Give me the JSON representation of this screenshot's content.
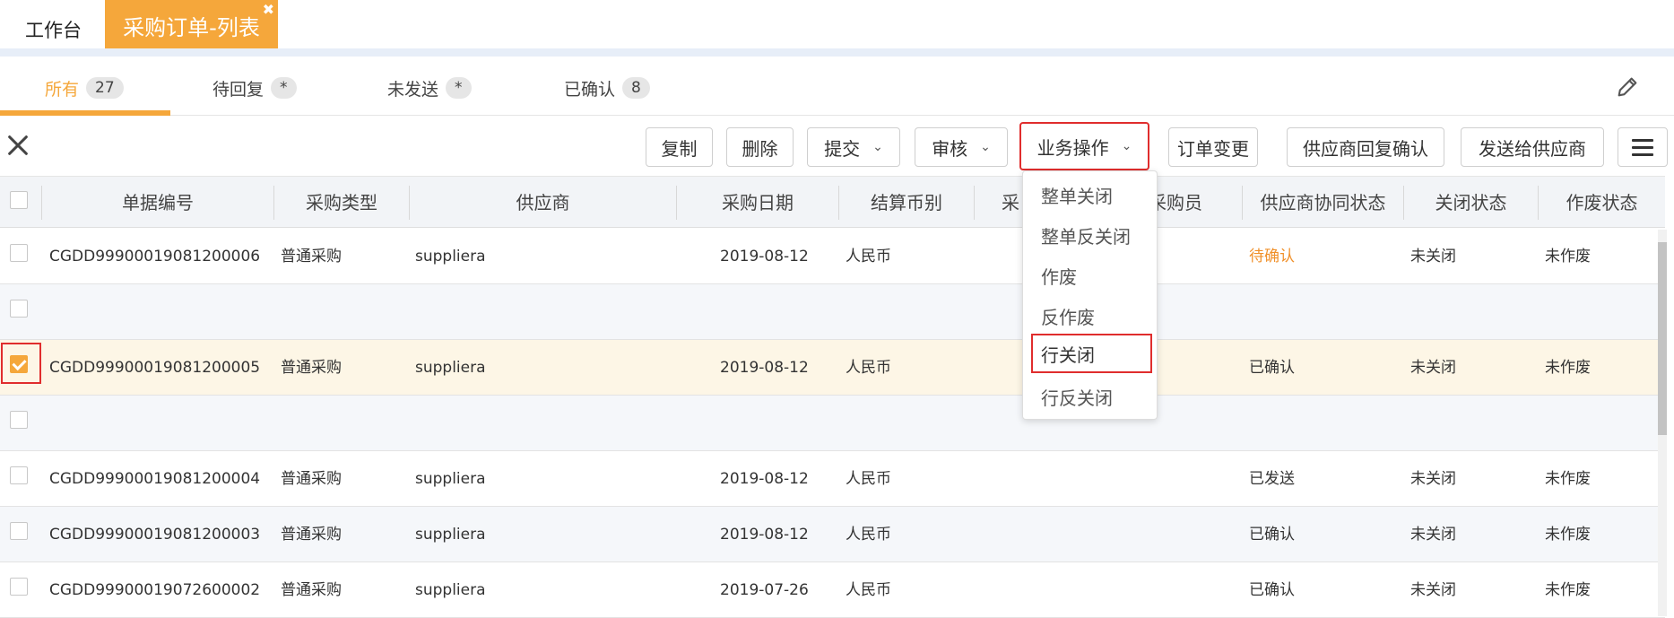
{
  "tabs": {
    "home": "工作台",
    "active": "采购订单-列表",
    "close": "✖"
  },
  "filters": [
    {
      "label": "所有",
      "count": "27"
    },
    {
      "label": "待回复",
      "count": "*"
    },
    {
      "label": "未发送",
      "count": "*"
    },
    {
      "label": "已确认",
      "count": "8"
    }
  ],
  "toolbar": {
    "copy": "复制",
    "delete": "删除",
    "submit": "提交",
    "review": "审核",
    "business_ops": "业务操作",
    "order_change": "订单变更",
    "supplier_reply_confirm": "供应商回复确认",
    "send_to_supplier": "发送给供应商"
  },
  "columns": [
    "单据编号",
    "采购类型",
    "供应商",
    "采购日期",
    "结算币别",
    "采",
    "采购员",
    "供应商协同状态",
    "关闭状态",
    "作废状态"
  ],
  "rows": [
    {
      "id": "CGDD99900019081200006",
      "type": "普通采购",
      "supplier": "suppliera",
      "date": "2019-08-12",
      "currency": "人民币",
      "collab": "待确认",
      "close": "未关闭",
      "void": "未作废",
      "checked": false
    },
    {
      "id": "",
      "type": "",
      "supplier": "",
      "date": "",
      "currency": "",
      "collab": "",
      "close": "",
      "void": "",
      "checked": false
    },
    {
      "id": "CGDD99900019081200005",
      "type": "普通采购",
      "supplier": "suppliera",
      "date": "2019-08-12",
      "currency": "人民币",
      "collab": "已确认",
      "close": "未关闭",
      "void": "未作废",
      "checked": true
    },
    {
      "id": "",
      "type": "",
      "supplier": "",
      "date": "",
      "currency": "",
      "collab": "",
      "close": "",
      "void": "",
      "checked": false
    },
    {
      "id": "CGDD99900019081200004",
      "type": "普通采购",
      "supplier": "suppliera",
      "date": "2019-08-12",
      "currency": "人民币",
      "collab": "已发送",
      "close": "未关闭",
      "void": "未作废",
      "checked": false
    },
    {
      "id": "CGDD99900019081200003",
      "type": "普通采购",
      "supplier": "suppliera",
      "date": "2019-08-12",
      "currency": "人民币",
      "collab": "已确认",
      "close": "未关闭",
      "void": "未作废",
      "checked": false
    },
    {
      "id": "CGDD99900019072600002",
      "type": "普通采购",
      "supplier": "suppliera",
      "date": "2019-07-26",
      "currency": "人民币",
      "collab": "已确认",
      "close": "未关闭",
      "void": "未作废",
      "checked": false
    }
  ],
  "dropdown": [
    "整单关闭",
    "整单反关闭",
    "作废",
    "反作废",
    "行关闭",
    "行反关闭"
  ],
  "colors": {
    "accent": "#f5a73b",
    "highlight": "#e02d2d",
    "pending": "#f0902a"
  },
  "icons": {
    "edit": "pencil-icon",
    "close": "close-icon",
    "menu": "hamburger-menu-icon",
    "chevron": "chevron-down-icon"
  }
}
